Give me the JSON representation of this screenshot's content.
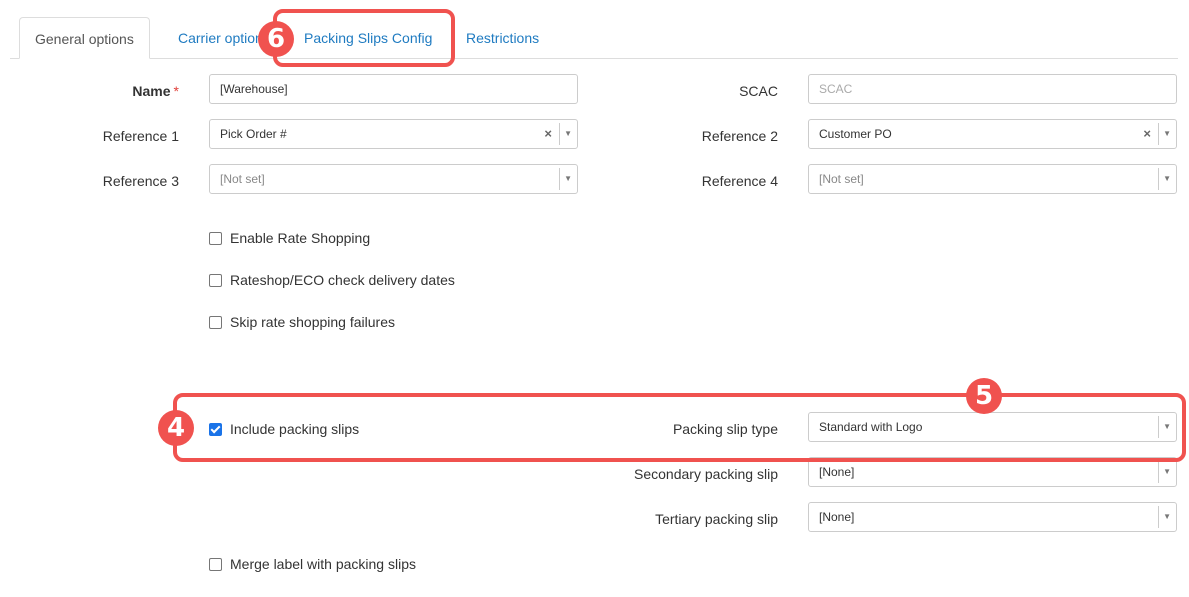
{
  "tabs": [
    {
      "label": "General options",
      "active": true
    },
    {
      "label": "Carrier option",
      "active": false
    },
    {
      "label": "Packing Slips Config",
      "active": false
    },
    {
      "label": "Restrictions",
      "active": false
    }
  ],
  "form": {
    "name": {
      "label": "Name",
      "required_mark": "*",
      "value": "[Warehouse]"
    },
    "scac": {
      "label": "SCAC",
      "placeholder": "SCAC"
    },
    "reference1": {
      "label": "Reference 1",
      "value": "Pick Order #",
      "clear": "×"
    },
    "reference2": {
      "label": "Reference 2",
      "value": "Customer PO",
      "clear": "×"
    },
    "reference3": {
      "label": "Reference 3",
      "value": "[Not set]"
    },
    "reference4": {
      "label": "Reference 4",
      "value": "[Not set]"
    }
  },
  "checkboxes": {
    "enable_rate_shopping": {
      "label": "Enable Rate Shopping",
      "checked": false
    },
    "rateshop_eco": {
      "label": "Rateshop/ECO check delivery dates",
      "checked": false
    },
    "skip_rate_failures": {
      "label": "Skip rate shopping failures",
      "checked": false
    },
    "include_packing_slips": {
      "label": "Include packing slips",
      "checked": true
    },
    "merge_label": {
      "label": "Merge label with packing slips",
      "checked": false
    }
  },
  "packing": {
    "type": {
      "label": "Packing slip type",
      "value": "Standard with Logo"
    },
    "secondary": {
      "label": "Secondary packing slip",
      "value": "[None]"
    },
    "tertiary": {
      "label": "Tertiary packing slip",
      "value": "[None]"
    }
  },
  "icons": {
    "dropdown": "▼"
  },
  "annotations": {
    "badge4": "4",
    "badge5": "5",
    "badge6": "6",
    "color": "#f0524f"
  }
}
